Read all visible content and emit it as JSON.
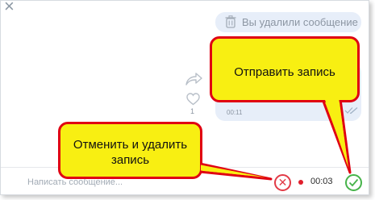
{
  "chat": {
    "deleted_message": "Вы удалили сообщение",
    "voice_message_time": "00:11",
    "like_count": "1",
    "close_glyph": "×"
  },
  "input": {
    "placeholder": "Написать сообщение...",
    "recording_time": "00:03",
    "cancel_glyph": "✕"
  },
  "callouts": {
    "send_record": "Отправить запись",
    "cancel_record": "Отменить и удалить запись"
  },
  "colors": {
    "bubble": "#e7eef9",
    "callout_fill": "#f8ef12",
    "callout_border": "#e00012",
    "cancel_red": "#e23a46",
    "send_green": "#46b34a"
  }
}
